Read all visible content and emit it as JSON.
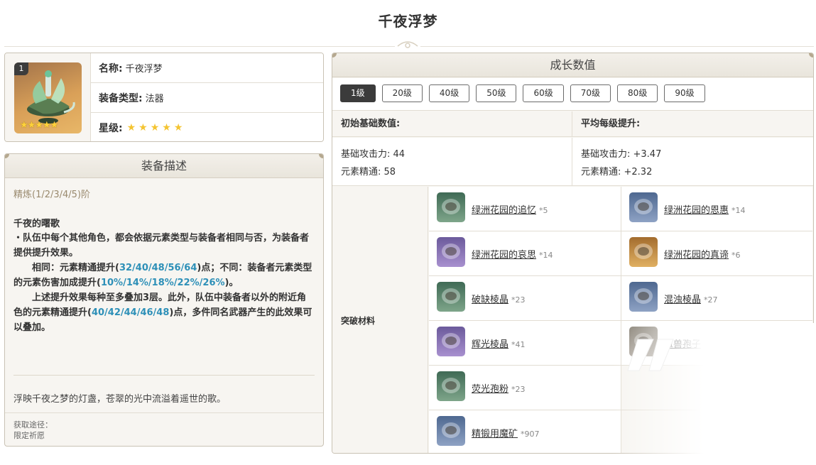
{
  "page": {
    "title": "千夜浮梦"
  },
  "info": {
    "refine_level": "1",
    "name_key": "名称:",
    "name_val": "千夜浮梦",
    "type_key": "装备类型:",
    "type_val": "法器",
    "rarity_key": "星级:",
    "rarity_stars": "★★★★★",
    "icon_stars": "★★★★★"
  },
  "description": {
    "title": "装备描述",
    "refine_label": "精炼(1/2/3/4/5)阶",
    "passive_name": "千夜的曙歌",
    "line1": "・队伍中每个其他角色，都会依据元素类型与装备者相同与否，为装备者提供提升效果。",
    "line2a": "　　相同：元素精通提升(",
    "line2b": "32/40/48/56/64",
    "line2c": ")点；不同：装备者元素类型的元素伤害加成提升(",
    "line2d": "10%/14%/18%/22%/26%",
    "line2e": ")。",
    "line3a": "　　上述提升效果每种至多叠加3层。此外，队伍中装备者以外的附近角色的元素精通提升(",
    "line3b": "40/42/44/46/48",
    "line3c": ")点，多件同名武器产生的此效果可以叠加。",
    "flavor": "浮映千夜之梦的灯盏，苍翠的光中流溢着遥世的歌。",
    "obtain_label": "获取途径：",
    "obtain_val": "限定祈愿"
  },
  "growth": {
    "title": "成长数值",
    "levels": [
      "1级",
      "20级",
      "40级",
      "50级",
      "60级",
      "70级",
      "80级",
      "90级"
    ],
    "active_level": "1级",
    "base_head": "初始基础数值:",
    "avg_head": "平均每级提升:",
    "base_atk": "基础攻击力: 44",
    "base_em": "元素精通: 58",
    "avg_atk": "基础攻击力: +3.47",
    "avg_em": "元素精通: +2.32",
    "materials_label": "突破材料",
    "materials": [
      {
        "name": "绿洲花园的追忆",
        "count": "*5",
        "icon": "memory-relic-icon",
        "color": "green"
      },
      {
        "name": "绿洲花园的恩惠",
        "count": "*14",
        "icon": "grace-relic-icon",
        "color": "blue"
      },
      {
        "name": "绿洲花园的哀思",
        "count": "*14",
        "icon": "mourning-relic-icon",
        "color": "purple"
      },
      {
        "name": "绿洲花园的真谛",
        "count": "*6",
        "icon": "truth-relic-icon",
        "color": "gold"
      },
      {
        "name": "破缺棱晶",
        "count": "*23",
        "icon": "damaged-prism-icon",
        "color": "green"
      },
      {
        "name": "混浊棱晶",
        "count": "*27",
        "icon": "turbid-prism-icon",
        "color": "blue"
      },
      {
        "name": "辉光棱晶",
        "count": "*41",
        "icon": "radiant-prism-icon",
        "color": "purple"
      },
      {
        "name": "蕈兽孢子",
        "count": "*15",
        "icon": "fungal-spores-icon",
        "color": "gray"
      },
      {
        "name": "荧光孢粉",
        "count": "*23",
        "icon": "luminescent-pollen-icon",
        "color": "green"
      },
      {
        "name": "精锻用魔矿",
        "count": "*907",
        "icon": "mystic-ore-icon",
        "color": "blue"
      }
    ]
  }
}
